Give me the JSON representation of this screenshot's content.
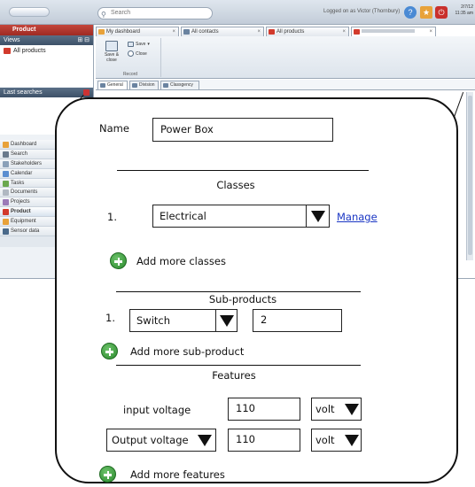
{
  "app": {
    "search_placeholder": "Search",
    "logged_in_text": "Logged on as Victor (Thornbury)",
    "date_line1": "2/7/12",
    "date_line2": "11:35 am"
  },
  "left_panel": {
    "header": "Product",
    "views_label": "Views",
    "views_items": [
      "All products"
    ],
    "last_searches_label": "Last searches",
    "nav": [
      "Dashboard",
      "Search",
      "Stakeholders",
      "Calendar",
      "Tasks",
      "Documents",
      "Projects",
      "Product",
      "Equipment",
      "Sensor data"
    ],
    "active_nav": "Product"
  },
  "tabs": [
    {
      "label": "My dashboard",
      "color": "#e8a23a"
    },
    {
      "label": "All contacts",
      "color": "#6a83a0"
    },
    {
      "label": "All products",
      "color": "#d23a2c"
    },
    {
      "label": "",
      "color": "#d23a2c"
    }
  ],
  "ribbon": {
    "save_close": "Save & close",
    "save": "Save",
    "close": "Close",
    "group_label": "Record"
  },
  "subtabs": [
    "General",
    "Division",
    "Classgency"
  ],
  "form": {
    "name_label": "Name",
    "name_value": "Power Box",
    "classes_heading": "Classes",
    "class_index": "1.",
    "class_value": "Electrical",
    "manage_link": "Manage",
    "add_classes": "Add more classes",
    "subproducts_heading": "Sub-products",
    "sub_index": "1.",
    "sub_value": "Switch",
    "sub_quantity": "2",
    "add_subproduct": "Add more sub-product",
    "features_heading": "Features",
    "features": [
      {
        "name": "input voltage",
        "value": "110",
        "unit": "volt"
      },
      {
        "name": "Output voltage",
        "value": "110",
        "unit": "volt"
      }
    ],
    "add_features": "Add more features"
  },
  "colors": {
    "accent_red": "#c4463c",
    "link_blue": "#1a36c4",
    "add_green": "#2c8a2e"
  }
}
